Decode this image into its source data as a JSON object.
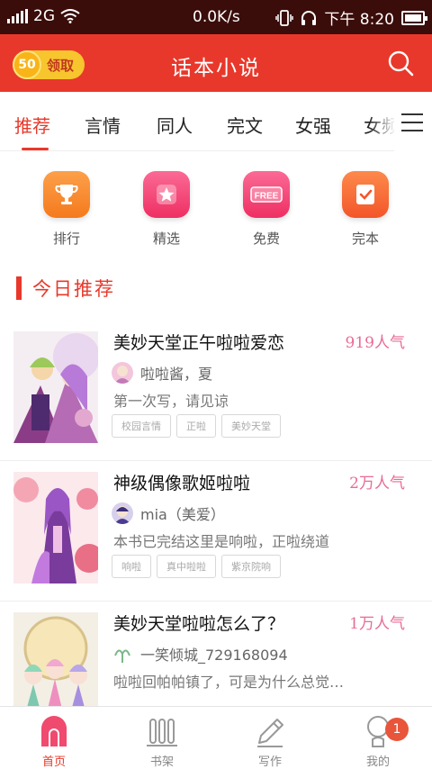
{
  "status_bar": {
    "network": "2G",
    "speed": "0.0K/s",
    "time": "下午 8:20"
  },
  "header": {
    "coin_value": "50",
    "coin_label": "领取",
    "title": "话本小说"
  },
  "tabs": [
    {
      "label": "推荐"
    },
    {
      "label": "言情"
    },
    {
      "label": "同人"
    },
    {
      "label": "完文"
    },
    {
      "label": "女强"
    },
    {
      "label": "女频"
    }
  ],
  "quick_entries": [
    {
      "label": "排行",
      "icon": "trophy-icon",
      "color": "#f98a2e"
    },
    {
      "label": "精选",
      "icon": "star-icon",
      "color": "#f3447a"
    },
    {
      "label": "免费",
      "icon": "free-icon",
      "color": "#f3447a",
      "icon_text": "FREE"
    },
    {
      "label": "完本",
      "icon": "check-icon",
      "color": "#f76531"
    }
  ],
  "section": {
    "title": "今日推荐"
  },
  "books": [
    {
      "title": "美妙天堂正午啦啦爱恋",
      "popularity": "919人气",
      "author": "啦啦酱，夏",
      "description": "第一次写，请见谅",
      "tags": [
        "校园言情",
        "正啦",
        "美妙天堂"
      ]
    },
    {
      "title": "神级偶像歌姬啦啦",
      "popularity": "2万人气",
      "author": "mia（美爱）",
      "description": "本书已完结这里是响啦，正啦绕道",
      "tags": [
        "响啦",
        "真中啦啦",
        "紫京院响"
      ]
    },
    {
      "title": "美妙天堂啦啦怎么了？",
      "popularity": "1万人气",
      "author": "一笑倾城_729168094",
      "description": "啦啦回帕帕镇了，可是为什么总觉…",
      "tags": []
    }
  ],
  "bottom_nav": [
    {
      "label": "首页",
      "icon": "home-icon"
    },
    {
      "label": "书架",
      "icon": "bookshelf-icon"
    },
    {
      "label": "写作",
      "icon": "pen-icon"
    },
    {
      "label": "我的",
      "icon": "profile-icon",
      "badge": "1"
    }
  ],
  "colors": {
    "brand_red": "#e8382b",
    "popularity_pink": "#e96b94",
    "coin_yellow": "#f7c52e"
  }
}
